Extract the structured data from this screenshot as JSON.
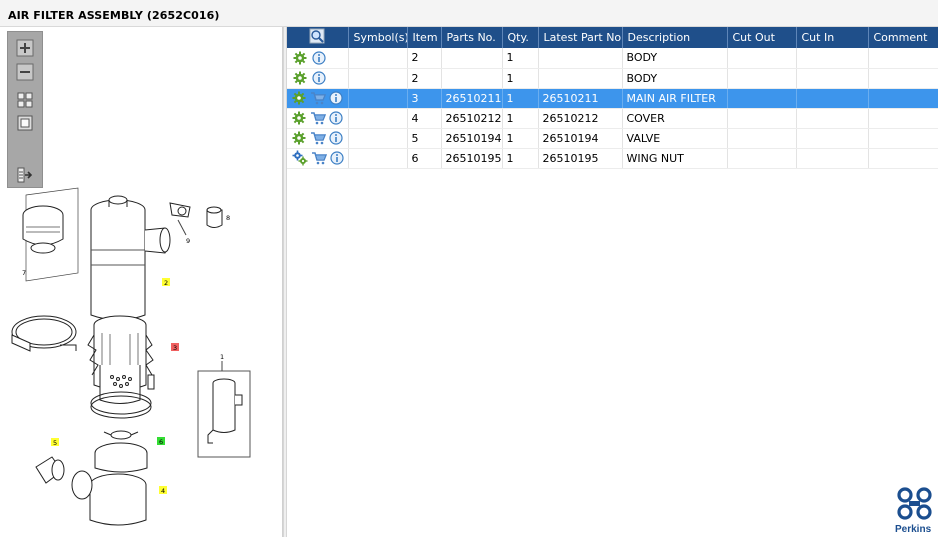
{
  "window": {
    "title": "AIR FILTER ASSEMBLY (2652C016)"
  },
  "toolbar": {
    "buttons": [
      {
        "icon": "zoom-in-icon"
      },
      {
        "icon": "zoom-out-icon"
      },
      {
        "icon": "fit-all-icon"
      },
      {
        "icon": "actual-size-icon"
      },
      {
        "icon": "export-icon"
      }
    ]
  },
  "diagram": {
    "callouts": [
      "1",
      "2",
      "3",
      "4",
      "5",
      "6",
      "7",
      "8",
      "9"
    ],
    "highlight_colors": {
      "yellow": "#ffff33",
      "red": "#f06060",
      "green": "#33dd33"
    }
  },
  "table": {
    "header_icon": "zoom-search-icon",
    "columns": [
      "Symbol(s)",
      "Item",
      "Parts No.",
      "Qty.",
      "Latest Part No.",
      "Description",
      "Cut Out",
      "Cut In",
      "Comment"
    ],
    "rows": [
      {
        "status_icon": "gear-icon",
        "cart": false,
        "item": "2",
        "part_no": "",
        "qty": "1",
        "latest": "",
        "description": "BODY",
        "cut_out": "",
        "cut_in": "",
        "comment": "",
        "selected": false
      },
      {
        "status_icon": "gear-icon",
        "cart": false,
        "item": "2",
        "part_no": "",
        "qty": "1",
        "latest": "",
        "description": "BODY",
        "cut_out": "",
        "cut_in": "",
        "comment": "",
        "selected": false
      },
      {
        "status_icon": "gear-icon",
        "cart": true,
        "item": "3",
        "part_no": "26510211",
        "qty": "1",
        "latest": "26510211",
        "description": "MAIN AIR FILTER",
        "cut_out": "",
        "cut_in": "",
        "comment": "",
        "selected": true
      },
      {
        "status_icon": "gear-icon",
        "cart": true,
        "item": "4",
        "part_no": "26510212",
        "qty": "1",
        "latest": "26510212",
        "description": "COVER",
        "cut_out": "",
        "cut_in": "",
        "comment": "",
        "selected": false
      },
      {
        "status_icon": "gear-icon",
        "cart": true,
        "item": "5",
        "part_no": "26510194",
        "qty": "1",
        "latest": "26510194",
        "description": "VALVE",
        "cut_out": "",
        "cut_in": "",
        "comment": "",
        "selected": false
      },
      {
        "status_icon": "gears-icon",
        "cart": true,
        "item": "6",
        "part_no": "26510195",
        "qty": "1",
        "latest": "26510195",
        "description": "WING NUT",
        "cut_out": "",
        "cut_in": "",
        "comment": "",
        "selected": false
      }
    ]
  },
  "brand": {
    "name": "Perkins",
    "color": "#1b4e8f"
  },
  "colors": {
    "header": "#1f4f8a",
    "selected_row": "#3d95ec",
    "gear": "#5aa02c",
    "info": "#3c7fc4"
  }
}
